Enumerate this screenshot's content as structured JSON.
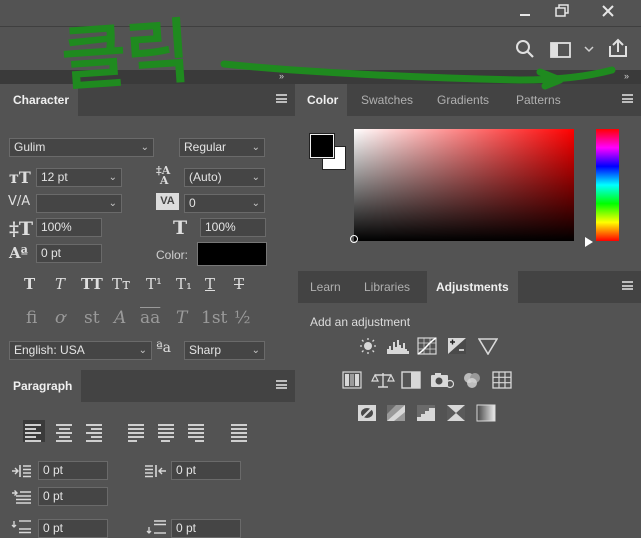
{
  "annotation": {
    "text": "클릭",
    "color": "#1f8a1f"
  },
  "window_buttons": [
    "minimize-icon",
    "restore-icon",
    "close-icon"
  ],
  "toolbar": {
    "icons": [
      "search-icon",
      "workspace-icon",
      "chevron-down-icon",
      "share-icon"
    ]
  },
  "character": {
    "tab": "Character",
    "font_family": "Gulim",
    "font_style": "Regular",
    "font_size": "12 pt",
    "leading": "(Auto)",
    "kerning": "",
    "tracking": "0",
    "vertical_scale": "100%",
    "horizontal_scale": "100%",
    "baseline_shift": "0 pt",
    "color_label": "Color:",
    "color_value": "#000000",
    "style_buttons": [
      "T",
      "T",
      "TT",
      "Tт",
      "T¹",
      "T₁",
      "T",
      "T"
    ],
    "opentype_buttons": [
      "fi",
      "ơ",
      "st",
      "A",
      "aa",
      "T",
      "1st",
      "½"
    ],
    "language": "English: USA",
    "aa_glyph": "ªa",
    "antialias": "Sharp"
  },
  "paragraph": {
    "tab": "Paragraph",
    "indent_left": "0 pt",
    "indent_right": "0 pt",
    "indent_first": "0 pt",
    "space_before": "0 pt",
    "space_after": "0 pt"
  },
  "color_panel": {
    "tabs": [
      "Color",
      "Swatches",
      "Gradients",
      "Patterns"
    ],
    "active_tab": "Color",
    "foreground": "#000000",
    "background": "#ffffff",
    "hue_color": "#ff0000"
  },
  "adjust_panel": {
    "tabs": [
      "Learn",
      "Libraries",
      "Adjustments"
    ],
    "active_tab": "Adjustments",
    "heading": "Add an adjustment"
  }
}
